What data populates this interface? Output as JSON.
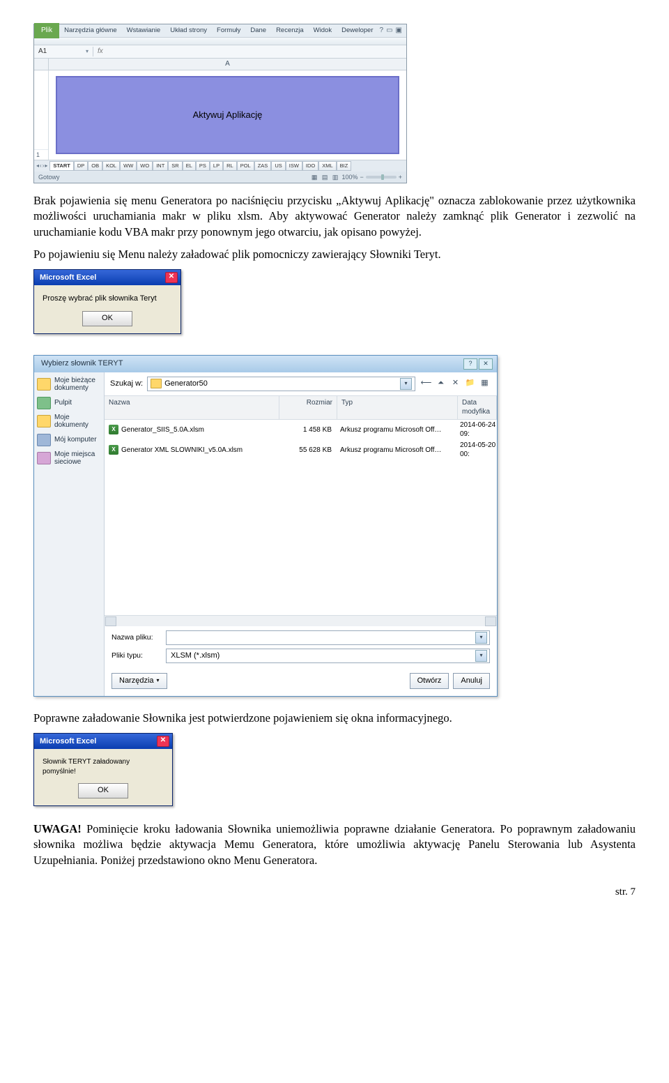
{
  "excel": {
    "file_tab": "Plik",
    "tabs": [
      "Narzędzia główne",
      "Wstawianie",
      "Układ strony",
      "Formuły",
      "Dane",
      "Recenzja",
      "Widok",
      "Deweloper"
    ],
    "namebox": "A1",
    "fx": "fx",
    "col": "A",
    "row_last": "1",
    "button_label": "Aktywuj Aplikację",
    "sheet_tabs": [
      "START",
      "DP",
      "OB",
      "KOL",
      "WW",
      "WO",
      "INT",
      "SR",
      "EL",
      "PS",
      "LP",
      "RL",
      "POL",
      "ZAS",
      "US",
      "ISW",
      "IDO",
      "XML",
      "BIZ"
    ],
    "status_left": "Gotowy",
    "zoom": "100%"
  },
  "para1": "Brak pojawienia się menu Generatora po naciśnięciu przycisku „Aktywuj Aplikację\" oznacza zablokowanie przez użytkownika możliwości uruchamiania makr w pliku xlsm. Aby aktywować Generator należy zamknąć plik Generator i zezwolić na uruchamianie kodu VBA makr przy ponownym jego otwarciu, jak opisano powyżej.",
  "para1b": "Po pojawieniu się Menu należy załadować plik pomocniczy zawierający Słowniki Teryt.",
  "msg1": {
    "title": "Microsoft Excel",
    "text": "Proszę wybrać plik słownika Teryt",
    "ok": "OK"
  },
  "filedlg": {
    "title": "Wybierz słownik TERYT",
    "lookin_label": "Szukaj w:",
    "lookin_value": "Generator50",
    "places": [
      "Moje bieżące dokumenty",
      "Pulpit",
      "Moje dokumenty",
      "Mój komputer",
      "Moje miejsca sieciowe"
    ],
    "cols": {
      "name": "Nazwa",
      "size": "Rozmiar",
      "type": "Typ",
      "date": "Data modyfika"
    },
    "rows": [
      {
        "name": "Generator_SIIS_5.0A.xlsm",
        "size": "1 458 KB",
        "type": "Arkusz programu Microsoft Off…",
        "date": "2014-06-24 09:"
      },
      {
        "name": "Generator XML SLOWNIKI_v5.0A.xlsm",
        "size": "55 628 KB",
        "type": "Arkusz programu Microsoft Off…",
        "date": "2014-05-20 00:"
      }
    ],
    "name_label": "Nazwa pliku:",
    "type_label": "Pliki typu:",
    "type_value": "XLSM (*.xlsm)",
    "tools": "Narzędzia",
    "open": "Otwórz",
    "cancel": "Anuluj"
  },
  "para2": "Poprawne załadowanie Słownika jest potwierdzone pojawieniem się okna informacyjnego.",
  "msg2": {
    "title": "Microsoft Excel",
    "text": "Słownik TERYT załadowany pomyślnie!",
    "ok": "OK"
  },
  "uwaga_label": "UWAGA!",
  "para3": " Pominięcie kroku ładowania Słownika uniemożliwia poprawne działanie Generatora. Po poprawnym załadowaniu słownika możliwa będzie aktywacja Memu Generatora, które umożliwia aktywację Panelu Sterowania lub Asystenta Uzupełniania. Poniżej przedstawiono okno Menu Generatora.",
  "page": "str. 7"
}
